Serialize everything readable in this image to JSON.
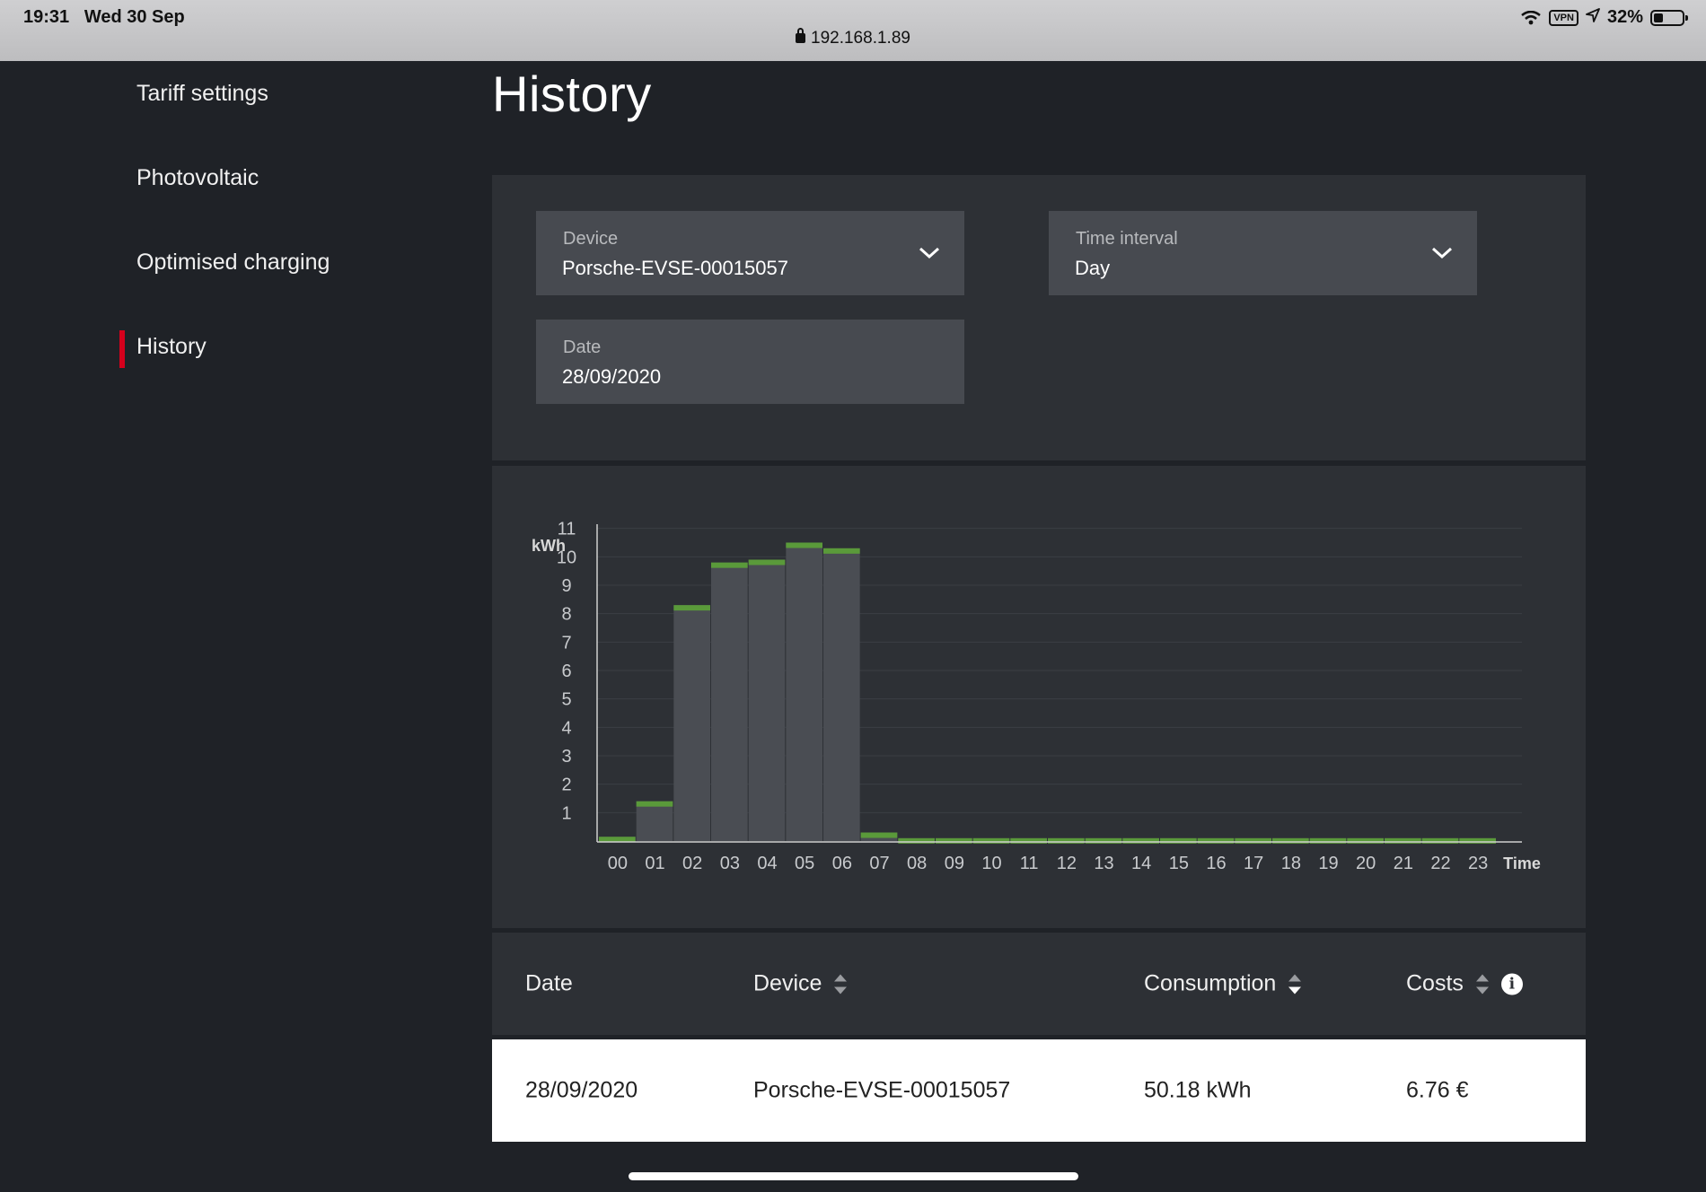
{
  "status_bar": {
    "time": "19:31",
    "date": "Wed 30 Sep",
    "url": "192.168.1.89",
    "vpn": "VPN",
    "battery": "32%",
    "battery_level": 0.32
  },
  "sidebar": {
    "items": [
      {
        "label": "Tariff settings",
        "active": false
      },
      {
        "label": "Photovoltaic",
        "active": false
      },
      {
        "label": "Optimised charging",
        "active": false
      },
      {
        "label": "History",
        "active": true
      }
    ]
  },
  "page": {
    "title": "History"
  },
  "filters": {
    "device": {
      "label": "Device",
      "value": "Porsche-EVSE-00015057"
    },
    "time_interval": {
      "label": "Time interval",
      "value": "Day"
    },
    "date": {
      "label": "Date",
      "value": "28/09/2020"
    }
  },
  "chart_data": {
    "type": "bar",
    "ylabel": "kWh",
    "xlabel": "Time",
    "yticks": [
      1,
      2,
      3,
      4,
      5,
      6,
      7,
      8,
      9,
      10,
      11
    ],
    "ylim": [
      0,
      12
    ],
    "categories": [
      "00",
      "01",
      "02",
      "03",
      "04",
      "05",
      "06",
      "07",
      "08",
      "09",
      "10",
      "11",
      "12",
      "13",
      "14",
      "15",
      "16",
      "17",
      "18",
      "19",
      "20",
      "21",
      "22",
      "23"
    ],
    "values": [
      0.15,
      1.4,
      8.3,
      9.8,
      9.9,
      10.5,
      10.3,
      0.3,
      0.1,
      0.1,
      0.1,
      0.1,
      0.1,
      0.1,
      0.1,
      0.1,
      0.1,
      0.1,
      0.1,
      0.1,
      0.1,
      0.1,
      0.1,
      0.1
    ],
    "bar_color": "#4a4d53",
    "cap_color": "#5a9a3a",
    "grid": true
  },
  "table": {
    "headers": {
      "date": "Date",
      "device": "Device",
      "consumption": "Consumption",
      "costs": "Costs"
    },
    "info_glyph": "i",
    "rows": [
      {
        "date": "28/09/2020",
        "device": "Porsche-EVSE-00015057",
        "consumption": "50.18 kWh",
        "costs": "6.76 €"
      }
    ]
  },
  "colors": {
    "background": "#1f2227",
    "panel": "#2d3035",
    "field": "#474a50",
    "accent_red": "#d5001c",
    "accent_green": "#5a9a3a"
  }
}
